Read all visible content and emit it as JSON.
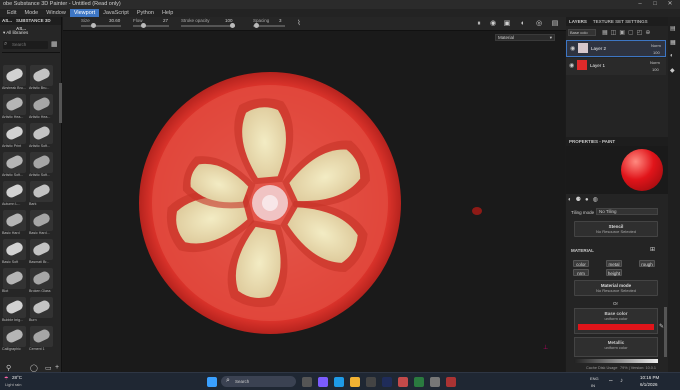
{
  "window": {
    "title": "obe Substance 3D Painter - Untitled (Read only)"
  },
  "menu": [
    "Edit",
    "Mode",
    "Window",
    "Viewport",
    "JavaScript",
    "Python",
    "Help"
  ],
  "active_menu": "Viewport",
  "toolbar": {
    "size_label": "Size",
    "size_value": "30.60",
    "flow_label": "Flow",
    "flow_value": "27",
    "stroke_opacity_label": "Stroke opacity",
    "stroke_opacity_value": "100",
    "spacing_label": "Spacing",
    "spacing_value": "3"
  },
  "shelf": {
    "tab_assets": "AS...",
    "tab_substance": "SUBSTANCE 3D AS...",
    "filter_label": "All libraries",
    "search_placeholder": "Search",
    "brushes": [
      "Airstreak Bru...",
      "Artistic Bru...",
      "Artistic Hea...",
      "Artistic Hea...",
      "Artistic Print",
      "Artistic Soft...",
      "Artistic Soft...",
      "Artistic Soft...",
      "Autumn L...",
      "Bark",
      "Basic Hard",
      "Basic Hard...",
      "Basic Soft",
      "Basmati Br...",
      "Blot",
      "Broken Glass",
      "Bubble brig...",
      "Burn",
      "Calligraphic",
      "Cement 1"
    ]
  },
  "viewport": {
    "mode_select": "Material"
  },
  "layers": {
    "tab_layers": "LAYERS",
    "tab_texture": "TEXTURE SET SETTINGS",
    "channel_select": "Base colo",
    "items": [
      {
        "name": "Layer 2",
        "blend": "Norm",
        "opacity": "100"
      },
      {
        "name": "Layer 1",
        "blend": "Norm",
        "opacity": "100"
      }
    ]
  },
  "properties": {
    "title": "PROPERTIES - PAINT",
    "tiling_label": "Tiling mode",
    "tiling_value": "No Tiling",
    "stencil_label": "Stencil",
    "stencil_value": "No Resource Selected",
    "material_label": "MATERIAL",
    "channels": [
      "color",
      "metal",
      "rough",
      "nrm",
      "height"
    ],
    "material_mode_label": "Material mode",
    "material_mode_value": "No Resource Selected",
    "or_label": "Or",
    "base_color_label": "Base color",
    "base_color_sub": "uniform color",
    "metallic_label": "Metallic",
    "metallic_sub": "uniform color",
    "base_color_hex": "#e0141a"
  },
  "status": {
    "cache": "Cache Disk Usage",
    "cache_value": "79% | Version: 10.0.1"
  },
  "taskbar": {
    "weather_temp": "28°C",
    "weather_desc": "Light rain",
    "search_placeholder": "Search",
    "lang": "ENG",
    "region": "IN",
    "time": "10:16 PM",
    "date": "6/1/2026"
  },
  "colors": {
    "accent": "#3d76c4",
    "tomato_skin": "#e23a2e",
    "tomato_flesh": "#d94a3c",
    "seed_gel": "#e8d8a8"
  }
}
